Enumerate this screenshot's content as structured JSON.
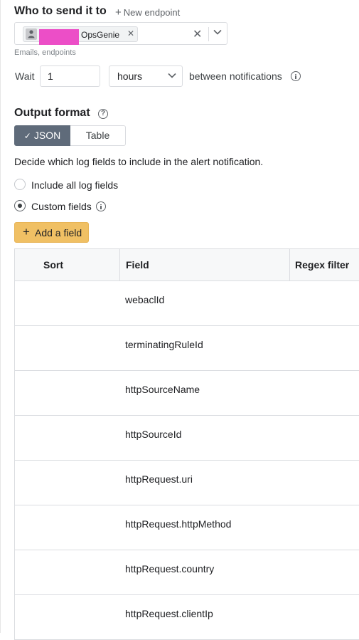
{
  "recipients": {
    "title": "Who to send it to",
    "new_endpoint_label": "New endpoint",
    "chip_label": "OpsGenie",
    "hint": "Emails, endpoints"
  },
  "wait": {
    "label": "Wait",
    "value": "1",
    "unit": "hours",
    "suffix": "between notifications"
  },
  "output_format": {
    "title": "Output format",
    "options": [
      "JSON",
      "Table"
    ],
    "selected": "JSON",
    "check_glyph": "✓",
    "description": "Decide which log fields to include in the alert notification.",
    "radios": [
      {
        "label": "Include all log fields",
        "selected": false
      },
      {
        "label": "Custom fields",
        "selected": true
      }
    ],
    "add_field_label": "Add a field"
  },
  "fields_table": {
    "columns": [
      "Sort",
      "Field",
      "Regex filter"
    ],
    "rows": [
      "webaclId",
      "terminatingRuleId",
      "httpSourceName",
      "httpSourceId",
      "httpRequest.uri",
      "httpRequest.httpMethod",
      "httpRequest.country",
      "httpRequest.clientIp"
    ]
  },
  "icons": {
    "chip_icon": "user-icon",
    "info": "info-icon",
    "help": "help-icon"
  },
  "colors": {
    "segment_active_bg": "#5f6b7a",
    "add_button_bg": "#f0c064",
    "redaction": "#ec4ec7"
  }
}
